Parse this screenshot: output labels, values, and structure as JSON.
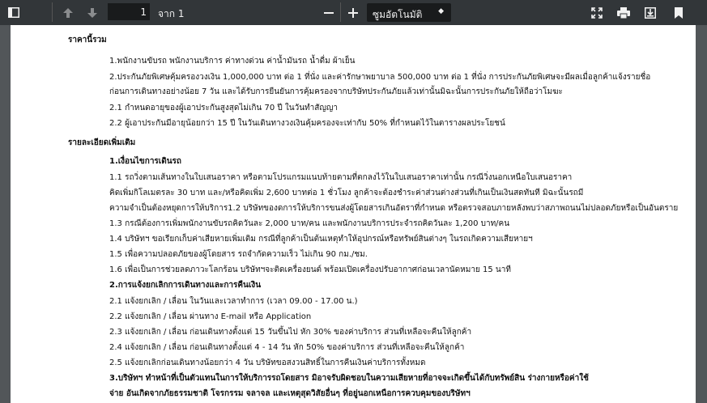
{
  "toolbar": {
    "page_current": "1",
    "page_total": "จาก 1",
    "zoom_value": "ซูมอัตโนมัติ",
    "zoom_caret": "◆",
    "icons": [
      "sidebar-toggle-icon",
      "arrow-up-icon",
      "arrow-down-icon",
      "minus-icon",
      "plus-icon",
      "fullscreen-icon",
      "print-icon",
      "download-icon",
      "bookmark-icon"
    ]
  },
  "doc": {
    "lines": [
      "ราคานี้รวม",
      "1.พนักงานขับรถ พนักงานบริการ ค่าทางด่วน ค่าน้ำมันรถ น้ำดื่ม ผ้าเย็น",
      "2.ประกันภัยพิเศษคุ้มครองวงเงิน 1,000,000 บาท ต่อ 1 ที่นั่ง และค่ารักษาพยาบาล 500,000 บาท ต่อ 1 ที่นั่ง การประกันภัยพิเศษจะมีผลเมื่อลูกค้าแจ้งรายชื่อ",
      "ก่อนการเดินทางอย่างน้อย 7 วัน และได้รับการยืนยันการคุ้มครองจากบริษัทประกันภัยแล้วเท่านั้นมิฉะนั้นการประกันภัยให้ถือว่าโมฆะ",
      "2.1 กำหนดอายุของผู้เอาประกันสูงสุดไม่เกิน 70 ปี ในวันทำสัญญา",
      "2.2 ผู้เอาประกันมีอายุน้อยกว่า 15 ปี ในวันเดินทางวงเงินคุ้มครองจะเท่ากับ 50% ที่กำหนดไว้ในตารางผลประโยชน์",
      "รายละเอียดเพิ่มเติม",
      "1.เงื่อนไขการเดินรถ",
      "1.1 รถวิ่งตามเส้นทางในใบเสนอราคา หรือตามโปรแกรมแนบท้ายตามที่ตกลงไว้ในใบเสนอราคาเท่านั้น กรณีวิ่งนอกเหนือใบเสนอราคา",
      "คิดเพิ่มกิโลเมตรละ 30 บาท และ/หรือคิดเพิ่ม 2,600 บาทต่อ 1 ชั่วโมง ลูกค้าจะต้องชำระค่าส่วนต่างส่วนที่เกินเป็นเงินสดทันที มิฉะนั้นรถมี",
      "ความจำเป็นต้องหยุดการให้บริการ1.2 บริษัทของดการให้บริการขนส่งผู้โดยสารเกินอัตราที่กำหนด หรือตรวจสอบภายหลังพบว่าสภาพถนนไม่ปลอดภัยหรือเป็นอันตราย",
      "1.3 กรณีต้องการเพิ่มพนักงานขับรถคิดวันละ 2,000 บาท/คน และพนักงานบริการประจำรถคิดวันละ 1,200 บาท/คน",
      "1.4 บริษัทฯ ขอเรียกเก็บค่าเสียหายเพิ่มเติม กรณีที่ลูกค้าเป็นต้นเหตุทำให้อุปกรณ์หรือทรัพย์สินต่างๆ ในรถเกิดความเสียหายฯ",
      "1.5 เพื่อความปลอดภัยของผู้โดยสาร รถจำกัดความเร็ว ไม่เกิน 90 กม./ชม.",
      "1.6 เพื่อเป็นการช่วยลดภาวะโลกร้อน บริษัทฯจะติดเครื่องยนต์ พร้อมเปิดเครื่องปรับอากาศก่อนเวลานัดหมาย 15 นาที",
      "2.การแจ้งยกเลิกการเดินทางและการคืนเงิน",
      "2.1 แจ้งยกเลิก / เลื่อน ในวันและเวลาทำการ (เวลา 09.00 - 17.00 น.)",
      "2.2 แจ้งยกเลิก / เลื่อน ผ่านทาง E-mail หรือ Application",
      "2.3 แจ้งยกเลิก / เลื่อน ก่อนเดินทางตั้งแต่ 15 วันขึ้นไป หัก 30% ของค่าบริการ ส่วนที่เหลือจะคืนให้ลูกค้า",
      "2.4 แจ้งยกเลิก / เลื่อน ก่อนเดินทางตั้งแต่ 4 - 14 วัน หัก 50% ของค่าบริการ ส่วนที่เหลือจะคืนให้ลูกค้า",
      "2.5 แจ้งยกเลิกก่อนเดินทางน้อยกว่า 4 วัน บริษัทขอสงวนสิทธิ์ในการคืนเงินค่าบริการทั้งหมด",
      "3.บริษัทฯ ทำหน้าที่เป็นตัวแทนในการให้บริการรถโดยสาร มิอาจรับผิดชอบในความเสียหายที่อาจจะเกิดขึ้นได้กับทรัพย์สิน ร่างกายหรือค่าใช้",
      "จ่าย อันเกิดจากภัยธรรมชาติ โจรกรรม จลาจล และเหตุสุดวิสัยอื่นๆ ที่อยู่นอกเหนือการควบคุมของบริษัทฯ"
    ]
  }
}
